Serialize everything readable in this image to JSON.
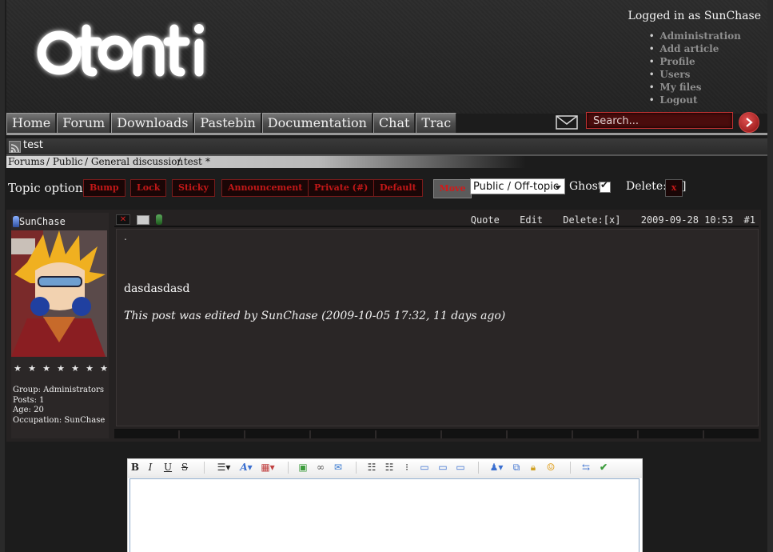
{
  "brand": {
    "logo_text": "otonti"
  },
  "user": {
    "logged_in_text": "Logged in as SunChase",
    "links": [
      "Administration",
      "Add article",
      "Profile",
      "Users",
      "My files",
      "Logout"
    ]
  },
  "nav": {
    "items": [
      "Home",
      "Forum",
      "Downloads",
      "Pastebin",
      "Documentation",
      "Chat",
      "Trac"
    ],
    "search_placeholder": "Search..."
  },
  "topic": {
    "title": "test",
    "breadcrumb": [
      "Forums",
      "/ Public",
      "/ General discussion",
      "/ test",
      "*"
    ]
  },
  "topic_options": {
    "label": "Topic options :",
    "buttons": [
      "Bump",
      "Lock",
      "Sticky",
      "Announcement",
      "Private (#)",
      "Default"
    ],
    "move_label": "Move",
    "move_selected": "Public / Off-topic",
    "ghost_label": "Ghost",
    "ghost_checked": true,
    "delete_label": "Delete:[",
    "delete_x": "x",
    "delete_close": "]"
  },
  "post": {
    "author": "SunChase",
    "stars": 7,
    "info": {
      "group": "Group:  Administrators",
      "posts": "Posts: 1",
      "age": "Age: 20",
      "occupation": "Occupation: SunChase"
    },
    "actions": {
      "quote": "Quote",
      "edit": "Edit",
      "delete": "Delete:[x]"
    },
    "timestamp": "2009-09-28 10:53",
    "number": "#1",
    "dot": ".",
    "body": "dasdasdasd",
    "edited_note": "This post was edited by SunChase (2009-10-05 17:32, 11 days ago)"
  },
  "editor": {
    "toolbar": {
      "bold": "B",
      "italic": "I",
      "underline": "U",
      "strike": "S"
    }
  }
}
